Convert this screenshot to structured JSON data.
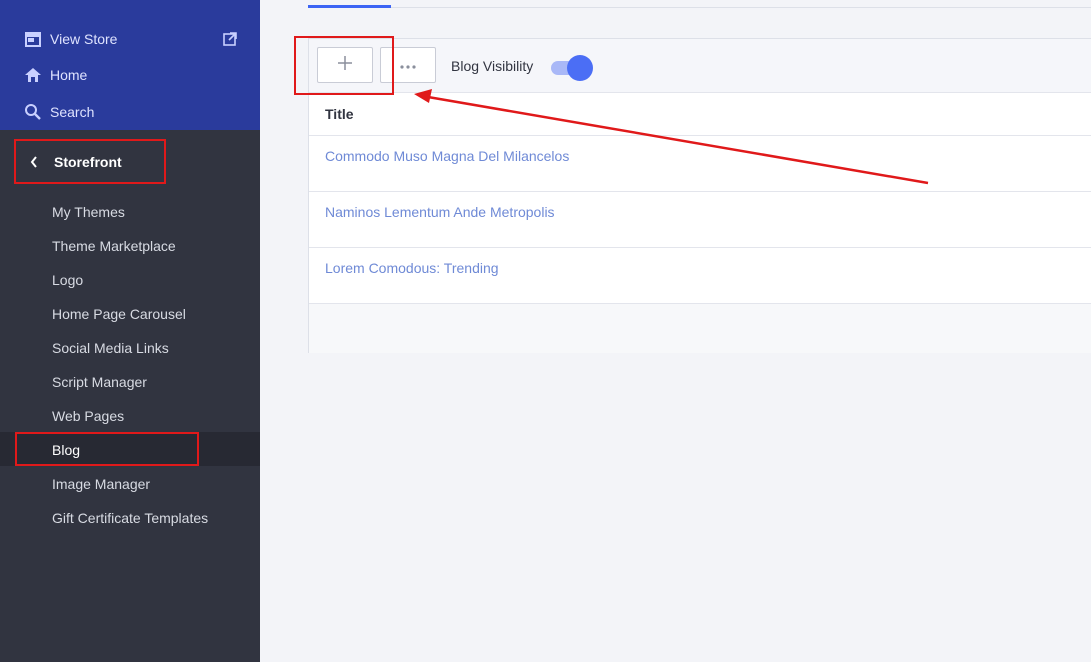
{
  "sidebar": {
    "top_items": [
      {
        "label": "View Store",
        "icon": "store-icon"
      },
      {
        "label": "Home",
        "icon": "home-icon"
      },
      {
        "label": "Search",
        "icon": "search-icon"
      }
    ],
    "section": {
      "label": "Storefront",
      "icon": "chevron-left-icon"
    },
    "sub_items": [
      {
        "label": "My Themes"
      },
      {
        "label": "Theme Marketplace"
      },
      {
        "label": "Logo"
      },
      {
        "label": "Home Page Carousel"
      },
      {
        "label": "Social Media Links"
      },
      {
        "label": "Script Manager"
      },
      {
        "label": "Web Pages"
      },
      {
        "label": "Blog",
        "active": true
      },
      {
        "label": "Image Manager"
      },
      {
        "label": "Gift Certificate Templates"
      }
    ]
  },
  "toolbar": {
    "add_icon": "plus-icon",
    "more_icon": "ellipsis-icon",
    "visibility_label": "Blog Visibility",
    "visibility_on": true
  },
  "table": {
    "header": "Title",
    "rows": [
      "Commodo Muso Magna Del Milancelos",
      "Naminos Lementum Ande Metropolis",
      "Lorem Comodous: Trending"
    ]
  },
  "colors": {
    "sidebar_bg": "#313440",
    "sidebar_top_bg": "#2a3b9c",
    "accent": "#4b6ef5",
    "link": "#6f8ad6",
    "annotation": "#e0191a"
  }
}
